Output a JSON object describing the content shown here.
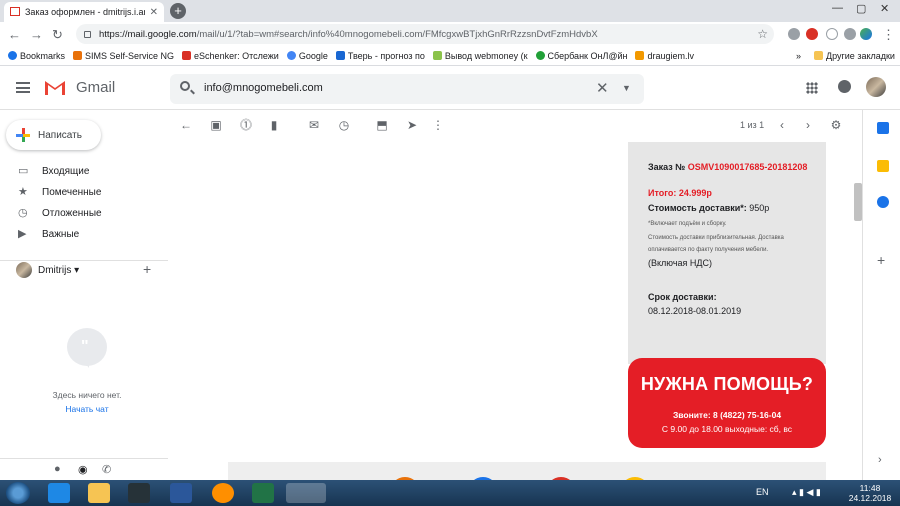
{
  "browser": {
    "tab_title": "Заказ оформлен - dmitrijs.i.am@",
    "url_host": "https://mail.google.com",
    "url_path": "/mail/u/1/?tab=wm#search/info%40mnogomebeli.com/FMfcgxwBTjxhGnRrRzzsnDvtFzmHdvbX",
    "bookmarks": [
      {
        "label": "Bookmarks",
        "color": "#1a73e8"
      },
      {
        "label": "SIMS Self-Service NG",
        "color": "#e8710a"
      },
      {
        "label": "eSchenker: Отслежи",
        "color": "#d93025"
      },
      {
        "label": "Google",
        "color": "#4285f4"
      },
      {
        "label": "Тверь - прогноз по",
        "color": "#1967d2"
      },
      {
        "label": "Вывод webmoney (к",
        "color": "#8bc34a"
      },
      {
        "label": "Сбербанк ОнЛ@йн",
        "color": "#21a038"
      },
      {
        "label": "draugiem.lv",
        "color": "#f29900"
      }
    ],
    "bookmarks_more": "»",
    "other_bookmarks": "Другие закладки"
  },
  "gmail": {
    "product": "Gmail",
    "search_query": "info@mnogomebeli.com",
    "compose_label": "Написать",
    "nav_items": [
      {
        "label": "Входящие",
        "icon": "inbox-icon",
        "glyph": "▭"
      },
      {
        "label": "Помеченные",
        "icon": "star-icon",
        "glyph": "★"
      },
      {
        "label": "Отложенные",
        "icon": "clock-icon",
        "glyph": "◷"
      },
      {
        "label": "Важные",
        "icon": "important-icon",
        "glyph": "▶"
      }
    ],
    "user_name": "Dmitrijs",
    "hangouts_empty": "Здесь ничего нет.",
    "start_chat": "Начать чат",
    "page_info": "1 из 1"
  },
  "email": {
    "order_label": "Заказ №",
    "order_number": "OSMV1090017685-20181208",
    "total": "Итого: 24.999р",
    "delivery_cost_label": "Стоимость доставки*:",
    "delivery_cost_value": "950р",
    "note1": "*Включает подъём и сборку.",
    "note2": "Стоимость доставки приблизительная. Доставка оплачивается по факту получения мебели.",
    "vat": "(Включая НДС)",
    "term_label": "Срок доставки:",
    "term_value": "08.12.2018-08.01.2019",
    "help_title": "НУЖНА ПОМОЩЬ?",
    "help_phone": "Звоните: 8 (4822) 75-16-04",
    "help_hours": "С 9.00 до 18.00 выходные: сб, вс",
    "colors": {
      "red": "#e41e26",
      "panel": "#e6e6e6"
    }
  },
  "taskbar": {
    "lang": "EN",
    "time": "11:48",
    "date": "24.12.2018"
  }
}
